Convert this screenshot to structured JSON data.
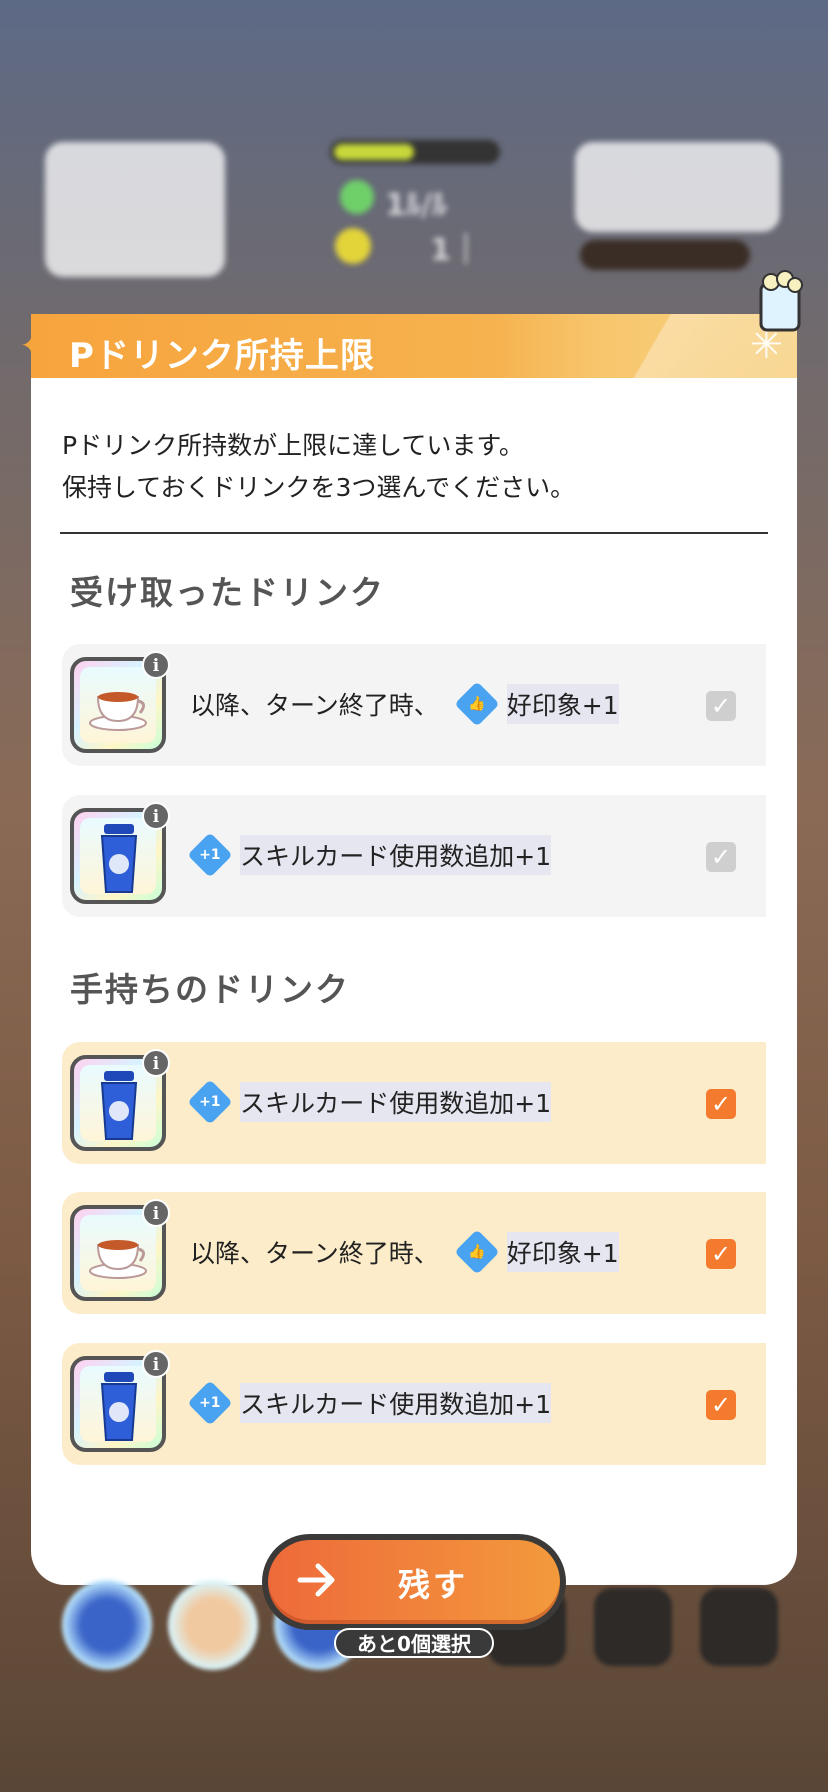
{
  "background": {
    "stat_1": "1ﾙ/ﾙ",
    "stat_2": "1｜"
  },
  "dialog": {
    "title": "Pドリンク所持上限",
    "description_line1": "Pドリンク所持数が上限に達しています。",
    "description_line2": "保持しておくドリンクを3つ選んでください。"
  },
  "sections": {
    "received_title": "受け取ったドリンク",
    "owned_title": "手持ちのドリンク"
  },
  "received_drinks": [
    {
      "drink": "tea-cup",
      "prefix": "以降、ターン終了時、",
      "chip_icon": "thumbs-up-icon",
      "effect": "好印象+1",
      "checked": true,
      "disabled": true
    },
    {
      "drink": "blue-bottle",
      "prefix": "",
      "chip_icon": "plus-one-card-icon",
      "effect": "スキルカード使用数追加+1",
      "checked": true,
      "disabled": true
    }
  ],
  "owned_drinks": [
    {
      "drink": "blue-bottle",
      "prefix": "",
      "chip_icon": "plus-one-card-icon",
      "effect": "スキルカード使用数追加+1",
      "checked": true
    },
    {
      "drink": "tea-cup",
      "prefix": "以降、ターン終了時、",
      "chip_icon": "thumbs-up-icon",
      "effect": "好印象+1",
      "checked": true
    },
    {
      "drink": "blue-bottle",
      "prefix": "",
      "chip_icon": "plus-one-card-icon",
      "effect": "スキルカード使用数追加+1",
      "checked": true
    }
  ],
  "info_badge": "i",
  "plus_one": "+1",
  "check_mark": "✓",
  "action": {
    "button_label": "残す",
    "remaining_text": "あと0個選択"
  },
  "colors": {
    "header_orange": "#f7a43d",
    "check_orange": "#f47a2e",
    "owned_row_bg": "#fcecc9",
    "received_row_bg": "#f4f4f4",
    "chip_blue": "#4aa3f0"
  }
}
